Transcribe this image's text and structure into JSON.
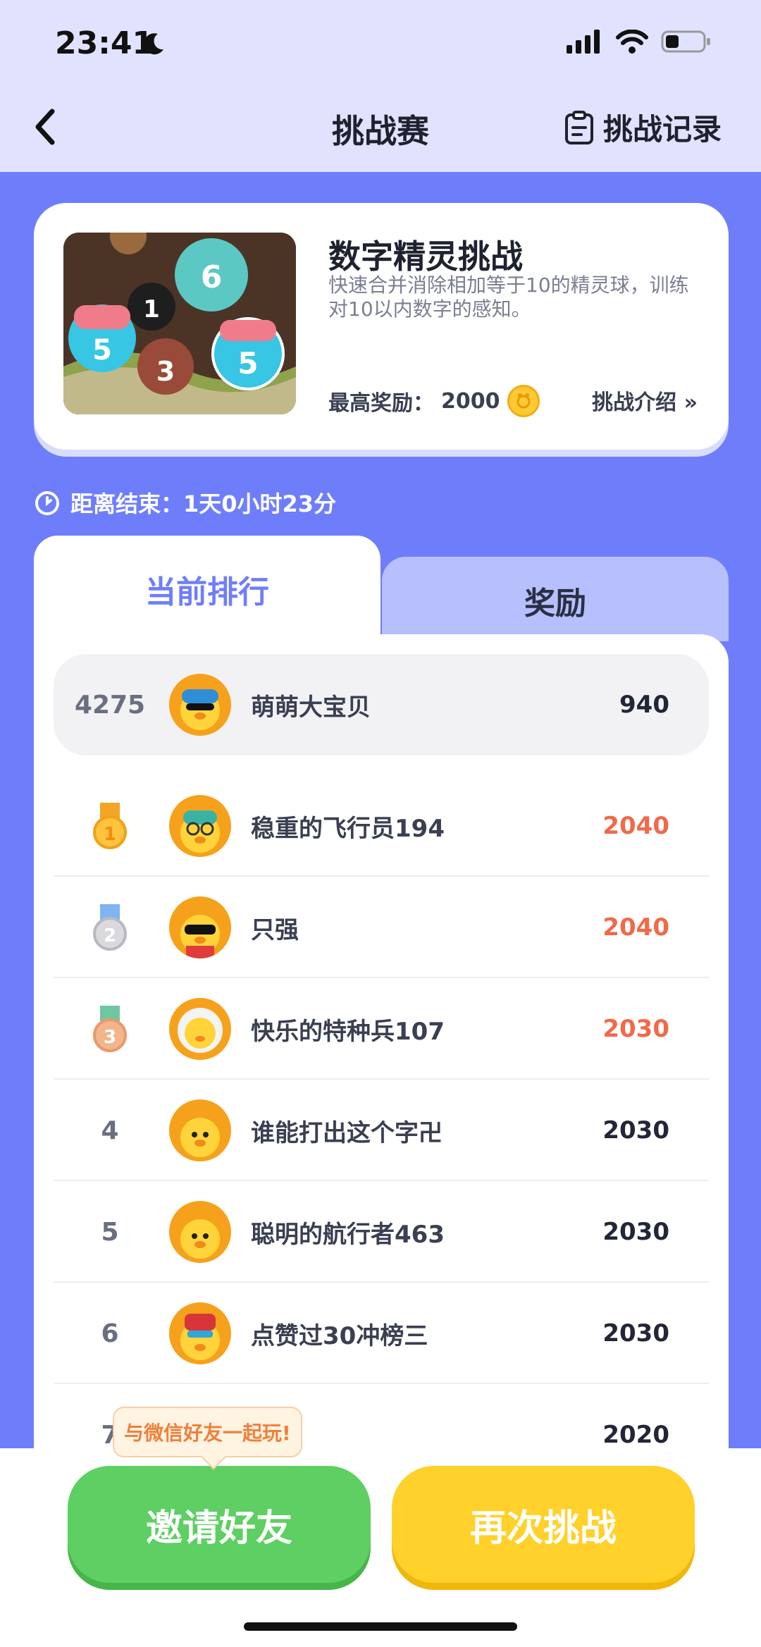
{
  "status_bar": {
    "time": "23:41"
  },
  "nav": {
    "title": "挑战赛",
    "record_label": "挑战记录"
  },
  "game": {
    "name": "数字精灵挑战",
    "description": "快速合并消除相加等于10的精灵球，训练对10以内数字的感知。",
    "reward_label": "最高奖励：",
    "reward_value": "2000",
    "intro_label": "挑战介绍 »"
  },
  "countdown": {
    "label": "距离结束：1天0小时23分"
  },
  "tabs": [
    {
      "label": "当前排行",
      "active": true
    },
    {
      "label": "奖励",
      "active": false
    }
  ],
  "my_rank": {
    "rank": "4275",
    "name": "萌萌大宝贝",
    "score": "940"
  },
  "leaderboard": [
    {
      "rank": "1",
      "medal": "gold",
      "name": "稳重的飞行员194",
      "score": "2040"
    },
    {
      "rank": "2",
      "medal": "silver",
      "name": "只强",
      "score": "2040"
    },
    {
      "rank": "3",
      "medal": "bronze",
      "name": "快乐的特种兵107",
      "score": "2030"
    },
    {
      "rank": "4",
      "name": "谁能打出这个字卍",
      "score": "2030"
    },
    {
      "rank": "5",
      "name": "聪明的航行者463",
      "score": "2030"
    },
    {
      "rank": "6",
      "name": "点赞过30冲榜三",
      "score": "2030"
    },
    {
      "rank": "7",
      "name": "",
      "score": "2020"
    }
  ],
  "bottom": {
    "tooltip": "与微信好友一起玩!",
    "invite_label": "邀请好友",
    "retry_label": "再次挑战"
  },
  "colors": {
    "accent": "#6E7EFB",
    "top_score": "#F06A4A",
    "invite": "#5ECF62",
    "retry": "#FFD12A"
  }
}
